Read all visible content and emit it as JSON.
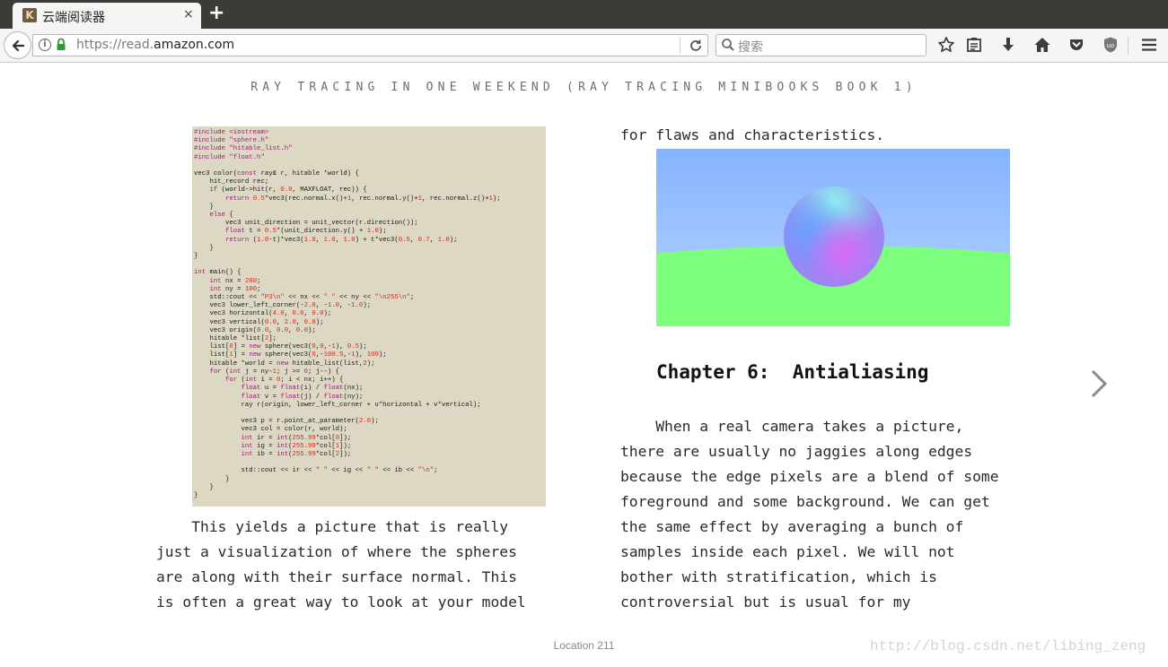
{
  "tab": {
    "title": "云端阅读器",
    "favicon_letter": "K",
    "close": "×",
    "new_tab": "+"
  },
  "nav": {
    "back": "←",
    "url_prefix": "https://read.",
    "url_host": "amazon.com",
    "reload": "⟳",
    "search_placeholder": "搜索"
  },
  "book": {
    "title": "RAY TRACING IN ONE WEEKEND (RAY TRACING MINIBOOKS BOOK 1)",
    "left_paragraph": "    This yields a picture that is really\njust a visualization of where the spheres\nare along with their surface normal. This\nis often a great way to look at your model",
    "right_top": "for flaws and characteristics.",
    "chapter_title": "Chapter 6:  Antialiasing",
    "right_paragraph": "    When a real camera takes a picture,\nthere are usually no jaggies along edges\nbecause the edge pixels are a blend of some\nforeground and some background. We can get\nthe same effect by averaging a bunch of\nsamples inside each pixel. We will not\nbother with stratification, which is\ncontroversial but is usual for my",
    "location": "Location 211",
    "watermark": "http://blog.csdn.net/libing_zeng"
  },
  "code_lines": [
    [
      [
        "pp",
        "#include <iostream>"
      ]
    ],
    [
      [
        "pp",
        "#include \"sphere.h\""
      ]
    ],
    [
      [
        "pp",
        "#include \"hitable_list.h\""
      ]
    ],
    [
      [
        "pp",
        "#include \"float.h\""
      ]
    ],
    [],
    [
      [
        "t",
        "vec3 color("
      ],
      [
        "kw",
        "const"
      ],
      [
        "t",
        " ray& r, hitable *world) {"
      ]
    ],
    [
      [
        "t",
        "    hit_record rec;"
      ]
    ],
    [
      [
        "t",
        "    "
      ],
      [
        "kw",
        "if"
      ],
      [
        "t",
        " (world->hit(r, "
      ],
      [
        "num",
        "0.0"
      ],
      [
        "t",
        ", MAXFLOAT, rec)) {"
      ]
    ],
    [
      [
        "t",
        "        "
      ],
      [
        "kw",
        "return"
      ],
      [
        "t",
        " "
      ],
      [
        "num",
        "0.5"
      ],
      [
        "t",
        "*vec3(rec.normal.x()+"
      ],
      [
        "num",
        "1"
      ],
      [
        "t",
        ", rec.normal.y()+"
      ],
      [
        "num",
        "1"
      ],
      [
        "t",
        ", rec.normal.z()+"
      ],
      [
        "num",
        "1"
      ],
      [
        "t",
        ");"
      ]
    ],
    [
      [
        "t",
        "    }"
      ]
    ],
    [
      [
        "t",
        "    "
      ],
      [
        "kw",
        "else"
      ],
      [
        "t",
        " {"
      ]
    ],
    [
      [
        "t",
        "        vec3 unit_direction = unit_vector(r.direction());"
      ]
    ],
    [
      [
        "t",
        "        "
      ],
      [
        "kw",
        "float"
      ],
      [
        "t",
        " t = "
      ],
      [
        "num",
        "0.5"
      ],
      [
        "t",
        "*(unit_direction.y() + "
      ],
      [
        "num",
        "1.0"
      ],
      [
        "t",
        ");"
      ]
    ],
    [
      [
        "t",
        "        "
      ],
      [
        "kw",
        "return"
      ],
      [
        "t",
        " ("
      ],
      [
        "num",
        "1.0"
      ],
      [
        "t",
        "-t)*vec3("
      ],
      [
        "num",
        "1.0"
      ],
      [
        "t",
        ", "
      ],
      [
        "num",
        "1.0"
      ],
      [
        "t",
        ", "
      ],
      [
        "num",
        "1.0"
      ],
      [
        "t",
        ") + t*vec3("
      ],
      [
        "num",
        "0.5"
      ],
      [
        "t",
        ", "
      ],
      [
        "num",
        "0.7"
      ],
      [
        "t",
        ", "
      ],
      [
        "num",
        "1.0"
      ],
      [
        "t",
        ");"
      ]
    ],
    [
      [
        "t",
        "    }"
      ]
    ],
    [
      [
        "t",
        "}"
      ]
    ],
    [],
    [
      [
        "kw",
        "int"
      ],
      [
        "t",
        " main() {"
      ]
    ],
    [
      [
        "t",
        "    "
      ],
      [
        "kw",
        "int"
      ],
      [
        "t",
        " nx = "
      ],
      [
        "num",
        "200"
      ],
      [
        "t",
        ";"
      ]
    ],
    [
      [
        "t",
        "    "
      ],
      [
        "kw",
        "int"
      ],
      [
        "t",
        " ny = "
      ],
      [
        "num",
        "100"
      ],
      [
        "t",
        ";"
      ]
    ],
    [
      [
        "t",
        "    std::cout << "
      ],
      [
        "str",
        "\"P3\\n\""
      ],
      [
        "t",
        " << nx << "
      ],
      [
        "str",
        "\" \""
      ],
      [
        "t",
        " << ny << "
      ],
      [
        "str",
        "\"\\n255\\n\""
      ],
      [
        "t",
        ";"
      ]
    ],
    [
      [
        "t",
        "    vec3 lower_left_corner(-"
      ],
      [
        "num",
        "2.0"
      ],
      [
        "t",
        ", -"
      ],
      [
        "num",
        "1.0"
      ],
      [
        "t",
        ", -"
      ],
      [
        "num",
        "1.0"
      ],
      [
        "t",
        ");"
      ]
    ],
    [
      [
        "t",
        "    vec3 horizontal("
      ],
      [
        "num",
        "4.0"
      ],
      [
        "t",
        ", "
      ],
      [
        "num",
        "0.0"
      ],
      [
        "t",
        ", "
      ],
      [
        "num",
        "0.0"
      ],
      [
        "t",
        ");"
      ]
    ],
    [
      [
        "t",
        "    vec3 vertical("
      ],
      [
        "num",
        "0.0"
      ],
      [
        "t",
        ", "
      ],
      [
        "num",
        "2.0"
      ],
      [
        "t",
        ", "
      ],
      [
        "num",
        "0.0"
      ],
      [
        "t",
        ");"
      ]
    ],
    [
      [
        "t",
        "    vec3 origin("
      ],
      [
        "num",
        "0.0"
      ],
      [
        "t",
        ", "
      ],
      [
        "num",
        "0.0"
      ],
      [
        "t",
        ", "
      ],
      [
        "num",
        "0.0"
      ],
      [
        "t",
        ");"
      ]
    ],
    [
      [
        "t",
        "    hitable *list["
      ],
      [
        "num",
        "2"
      ],
      [
        "t",
        "];"
      ]
    ],
    [
      [
        "t",
        "    list["
      ],
      [
        "num",
        "0"
      ],
      [
        "t",
        "] = "
      ],
      [
        "kw",
        "new"
      ],
      [
        "t",
        " sphere(vec3("
      ],
      [
        "num",
        "0"
      ],
      [
        "t",
        ","
      ],
      [
        "num",
        "0"
      ],
      [
        "t",
        ",-"
      ],
      [
        "num",
        "1"
      ],
      [
        "t",
        "), "
      ],
      [
        "num",
        "0.5"
      ],
      [
        "t",
        ");"
      ]
    ],
    [
      [
        "t",
        "    list["
      ],
      [
        "num",
        "1"
      ],
      [
        "t",
        "] = "
      ],
      [
        "kw",
        "new"
      ],
      [
        "t",
        " sphere(vec3("
      ],
      [
        "num",
        "0"
      ],
      [
        "t",
        ",-"
      ],
      [
        "num",
        "100.5"
      ],
      [
        "t",
        ",-"
      ],
      [
        "num",
        "1"
      ],
      [
        "t",
        "), "
      ],
      [
        "num",
        "100"
      ],
      [
        "t",
        ");"
      ]
    ],
    [
      [
        "t",
        "    hitable *world = "
      ],
      [
        "kw",
        "new"
      ],
      [
        "t",
        " hitable_list(list,"
      ],
      [
        "num",
        "2"
      ],
      [
        "t",
        ");"
      ]
    ],
    [
      [
        "t",
        "    "
      ],
      [
        "kw",
        "for"
      ],
      [
        "t",
        " ("
      ],
      [
        "kw",
        "int"
      ],
      [
        "t",
        " j = ny-"
      ],
      [
        "num",
        "1"
      ],
      [
        "t",
        "; j >= "
      ],
      [
        "num",
        "0"
      ],
      [
        "t",
        "; j--) {"
      ]
    ],
    [
      [
        "t",
        "        "
      ],
      [
        "kw",
        "for"
      ],
      [
        "t",
        " ("
      ],
      [
        "kw",
        "int"
      ],
      [
        "t",
        " i = "
      ],
      [
        "num",
        "0"
      ],
      [
        "t",
        "; i < nx; i++) {"
      ]
    ],
    [
      [
        "t",
        "            "
      ],
      [
        "kw",
        "float"
      ],
      [
        "t",
        " u = "
      ],
      [
        "kw",
        "float"
      ],
      [
        "t",
        "(i) / "
      ],
      [
        "kw",
        "float"
      ],
      [
        "t",
        "(nx);"
      ]
    ],
    [
      [
        "t",
        "            "
      ],
      [
        "kw",
        "float"
      ],
      [
        "t",
        " v = "
      ],
      [
        "kw",
        "float"
      ],
      [
        "t",
        "(j) / "
      ],
      [
        "kw",
        "float"
      ],
      [
        "t",
        "(ny);"
      ]
    ],
    [
      [
        "t",
        "            ray r(origin, lower_left_corner + u*horizontal + v*vertical);"
      ]
    ],
    [],
    [
      [
        "t",
        "            vec3 p = r.point_at_parameter("
      ],
      [
        "num",
        "2.0"
      ],
      [
        "t",
        ");"
      ]
    ],
    [
      [
        "t",
        "            vec3 col = color(r, world);"
      ]
    ],
    [
      [
        "t",
        "            "
      ],
      [
        "kw",
        "int"
      ],
      [
        "t",
        " ir = "
      ],
      [
        "kw",
        "int"
      ],
      [
        "t",
        "("
      ],
      [
        "num",
        "255.99"
      ],
      [
        "t",
        "*col["
      ],
      [
        "num",
        "0"
      ],
      [
        "t",
        "]);"
      ]
    ],
    [
      [
        "t",
        "            "
      ],
      [
        "kw",
        "int"
      ],
      [
        "t",
        " ig = "
      ],
      [
        "kw",
        "int"
      ],
      [
        "t",
        "("
      ],
      [
        "num",
        "255.99"
      ],
      [
        "t",
        "*col["
      ],
      [
        "num",
        "1"
      ],
      [
        "t",
        "]);"
      ]
    ],
    [
      [
        "t",
        "            "
      ],
      [
        "kw",
        "int"
      ],
      [
        "t",
        " ib = "
      ],
      [
        "kw",
        "int"
      ],
      [
        "t",
        "("
      ],
      [
        "num",
        "255.99"
      ],
      [
        "t",
        "*col["
      ],
      [
        "num",
        "2"
      ],
      [
        "t",
        "]);"
      ]
    ],
    [],
    [
      [
        "t",
        "            std::cout << ir << "
      ],
      [
        "str",
        "\" \""
      ],
      [
        "t",
        " << ig << "
      ],
      [
        "str",
        "\" \""
      ],
      [
        "t",
        " << ib << "
      ],
      [
        "str",
        "\"\\n\""
      ],
      [
        "t",
        ";"
      ]
    ],
    [
      [
        "t",
        "        }"
      ]
    ],
    [
      [
        "t",
        "    }"
      ]
    ],
    [
      [
        "t",
        "}"
      ]
    ]
  ],
  "icons": [
    "back-arrow-icon",
    "info-icon",
    "lock-icon",
    "reload-icon",
    "search-icon",
    "bookmark-star-icon",
    "reading-list-icon",
    "download-icon",
    "home-icon",
    "pocket-icon",
    "ublock-icon",
    "hamburger-menu-icon",
    "next-page-chevron-icon"
  ]
}
